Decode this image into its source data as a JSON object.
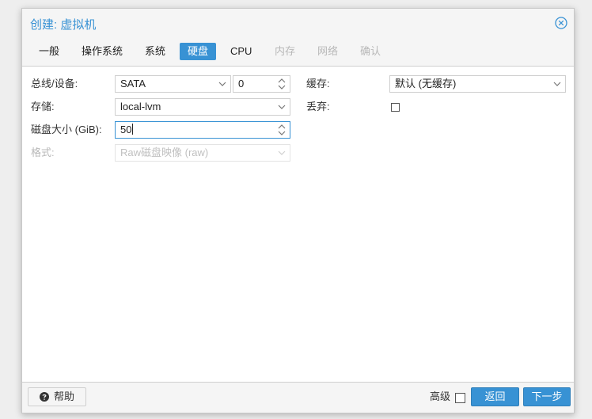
{
  "window": {
    "title": "创建: 虚拟机"
  },
  "tabs": [
    {
      "label": "一般",
      "state": "normal"
    },
    {
      "label": "操作系统",
      "state": "normal"
    },
    {
      "label": "系统",
      "state": "normal"
    },
    {
      "label": "硬盘",
      "state": "active"
    },
    {
      "label": "CPU",
      "state": "normal"
    },
    {
      "label": "内存",
      "state": "disabled"
    },
    {
      "label": "网络",
      "state": "disabled"
    },
    {
      "label": "确认",
      "state": "disabled"
    }
  ],
  "form": {
    "bus_label": "总线/设备:",
    "bus_value": "SATA",
    "device_value": "0",
    "storage_label": "存储:",
    "storage_value": "local-lvm",
    "size_label": "磁盘大小 (GiB):",
    "size_value": "50",
    "format_label": "格式:",
    "format_value": "Raw磁盘映像 (raw)",
    "cache_label": "缓存:",
    "cache_value": "默认 (无缓存)",
    "discard_label": "丢弃:",
    "discard_checked": false
  },
  "footer": {
    "help_label": "帮助",
    "advanced_label": "高级",
    "advanced_checked": false,
    "back_label": "返回",
    "next_label": "下一步"
  },
  "colors": {
    "accent": "#3892d4",
    "disabled_text": "#b8b8b8"
  },
  "icons": {
    "close": "close-circle-icon",
    "help": "question-circle-icon",
    "dropdown": "chevron-down-icon",
    "spinner": "spinner-arrows-icon"
  }
}
